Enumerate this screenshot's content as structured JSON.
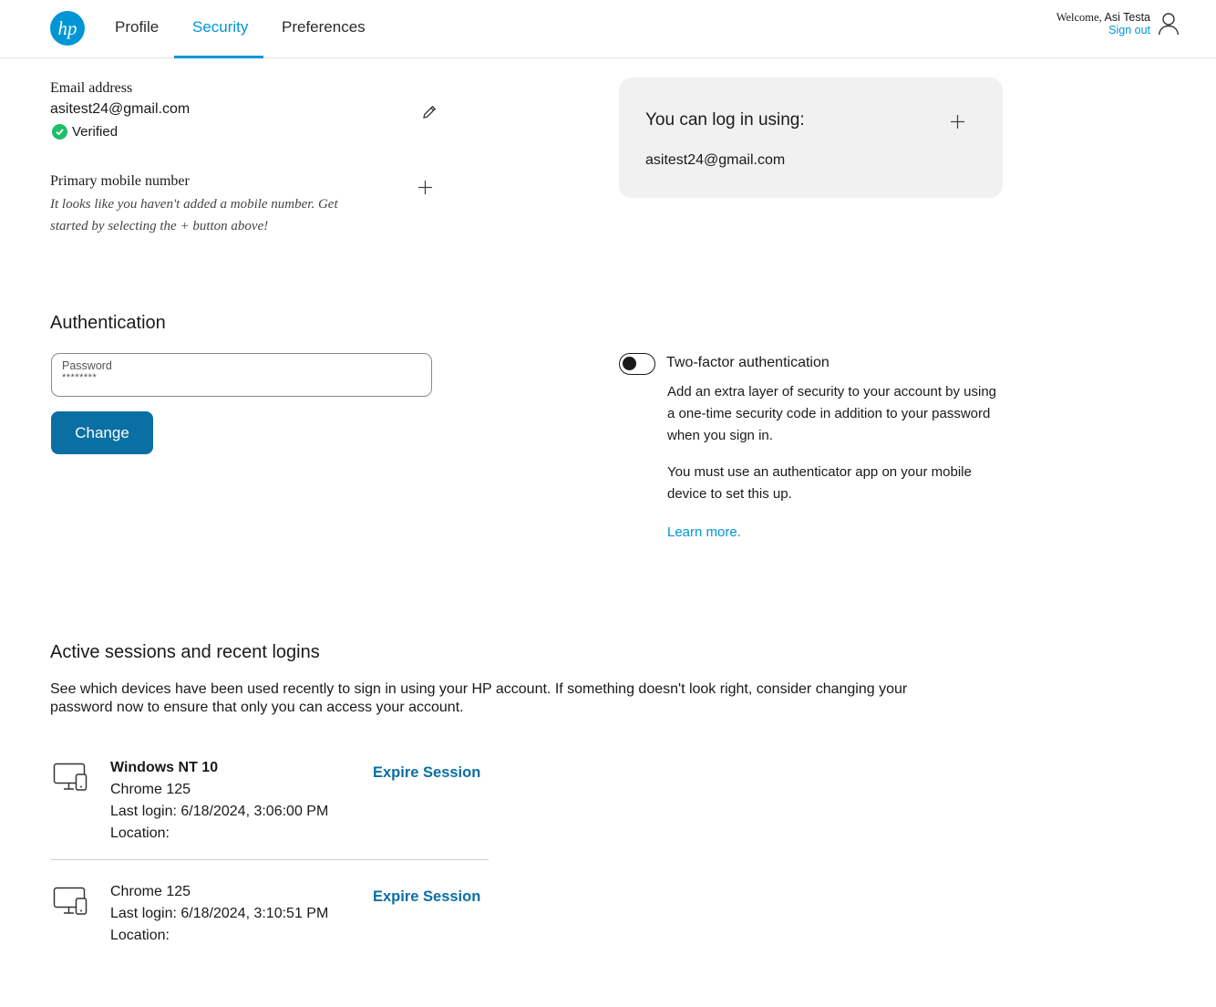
{
  "header": {
    "logo_text": "hp",
    "tabs": [
      {
        "label": "Profile"
      },
      {
        "label": "Security"
      },
      {
        "label": "Preferences"
      }
    ],
    "welcome_prefix": "Welcome,",
    "user_name": "Asi Testa",
    "sign_out": "Sign out"
  },
  "email": {
    "label": "Email address",
    "value": "asitest24@gmail.com",
    "status": "Verified"
  },
  "mobile": {
    "label": "Primary mobile number",
    "hint": "It looks like you haven't added a mobile number. Get started by selecting the + button above!"
  },
  "login_card": {
    "title": "You can log in using:",
    "email": "asitest24@gmail.com"
  },
  "authentication": {
    "title": "Authentication",
    "password_label": "Password",
    "password_value": "********",
    "change_button": "Change"
  },
  "two_factor": {
    "title": "Two-factor authentication",
    "enabled": false,
    "description_1": "Add an extra layer of security to your account by using a one-time security code in addition to your password when you sign in.",
    "description_2": "You must use an authenticator app on your mobile device to set this up.",
    "learn_more": "Learn more."
  },
  "sessions": {
    "title": "Active sessions and recent logins",
    "description": "See which devices have been used recently to sign in using your HP account. If something doesn't look right, consider changing your password now to ensure that only you can access your account.",
    "items": [
      {
        "os": "Windows NT 10",
        "browser": "Chrome 125",
        "last_login": "Last login: 6/18/2024, 3:06:00 PM",
        "location": "Location:",
        "action": "Expire Session"
      },
      {
        "os": "",
        "browser": "Chrome 125",
        "last_login": "Last login: 6/18/2024, 3:10:51 PM",
        "location": "Location:",
        "action": "Expire Session"
      }
    ]
  },
  "colors": {
    "accent": "#0096d6",
    "button": "#0a6fa3",
    "verified": "#1fbf6a",
    "card_bg": "#f1f1f1"
  },
  "icons": [
    "hp-logo",
    "user-icon",
    "check-icon",
    "pencil-icon",
    "plus-icon",
    "device-icon"
  ]
}
